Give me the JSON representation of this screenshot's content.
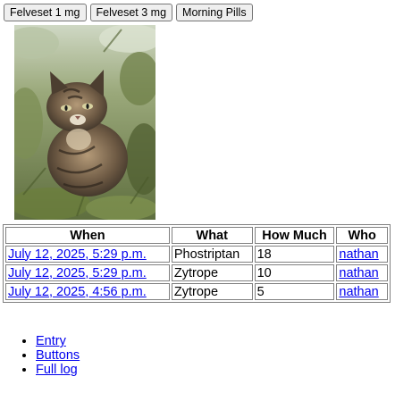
{
  "buttons": [
    {
      "label": "Felveset 1 mg"
    },
    {
      "label": "Felveset 3 mg"
    },
    {
      "label": "Morning Pills"
    }
  ],
  "table": {
    "headers": [
      "When",
      "What",
      "How Much",
      "Who"
    ],
    "rows": [
      {
        "when": "July 12, 2025, 5:29 p.m.",
        "what": "Phostriptan",
        "amount": "18",
        "who": "nathan"
      },
      {
        "when": "July 12, 2025, 5:29 p.m.",
        "what": "Zytrope",
        "amount": "10",
        "who": "nathan"
      },
      {
        "when": "July 12, 2025, 4:56 p.m.",
        "what": "Zytrope",
        "amount": "5",
        "who": "nathan"
      }
    ]
  },
  "links": [
    {
      "label": "Entry"
    },
    {
      "label": "Buttons"
    },
    {
      "label": "Full log"
    }
  ]
}
